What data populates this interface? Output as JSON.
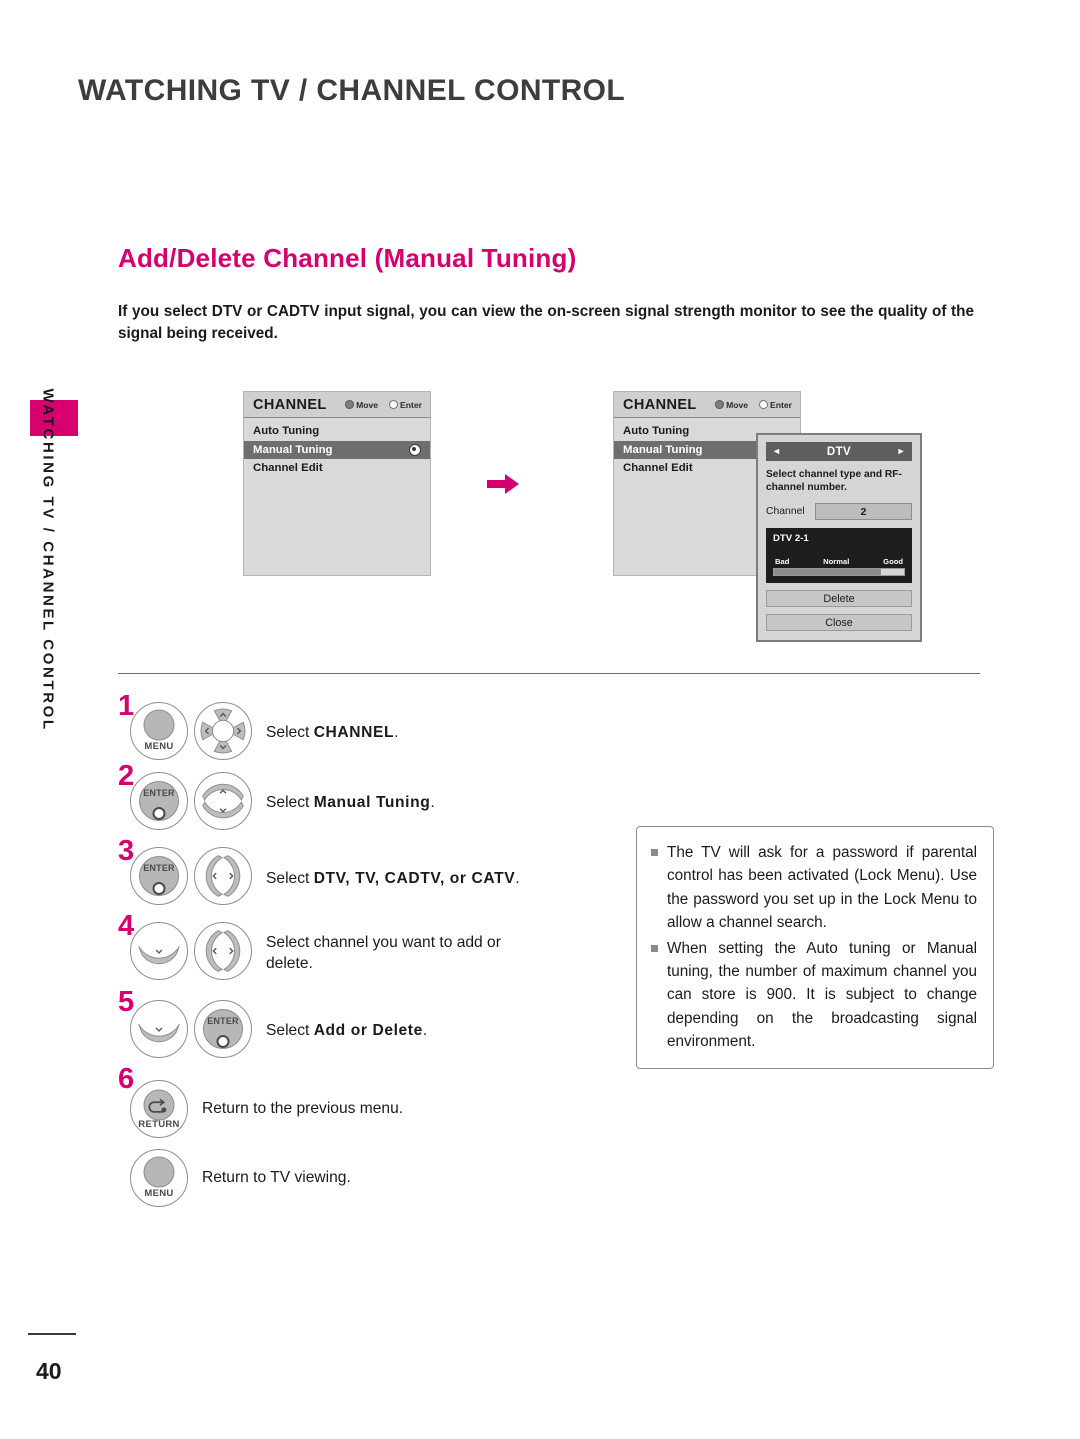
{
  "running_head": "WATCHING TV / CHANNEL CONTROL",
  "side_tab_label": "WATCHING TV / CHANNEL CONTROL",
  "section": {
    "title": "Add/Delete Channel (Manual Tuning)",
    "intro": "If you select DTV or CADTV input signal, you can view the on-screen signal strength monitor to see the quality of the signal being received."
  },
  "osd_left": {
    "header_title": "CHANNEL",
    "hint_move": "Move",
    "hint_enter": "Enter",
    "rows": [
      {
        "label": "Auto Tuning",
        "selected": false
      },
      {
        "label": "Manual Tuning",
        "selected": true
      },
      {
        "label": "Channel Edit",
        "selected": false
      }
    ]
  },
  "osd_right": {
    "header_title": "CHANNEL",
    "hint_move": "Move",
    "hint_enter": "Enter",
    "rows": [
      {
        "label": "Auto Tuning",
        "selected": false
      },
      {
        "label": "Manual Tuning",
        "selected": true
      },
      {
        "label": "Channel Edit",
        "selected": false
      }
    ]
  },
  "dtv_dialog": {
    "title": "DTV",
    "prev_arrow": "◄",
    "next_arrow": "►",
    "description": "Select channel type and RF-channel number.",
    "channel_label": "Channel",
    "channel_value": "2",
    "signal_id": "DTV 2-1",
    "scale_bad": "Bad",
    "scale_normal": "Normal",
    "scale_good": "Good",
    "signal_percent": 82,
    "delete_button": "Delete",
    "close_button": "Close"
  },
  "steps": [
    {
      "num": "1",
      "text_plain": "Select ",
      "text_bold": "CHANNEL",
      "text_tail": "."
    },
    {
      "num": "2",
      "text_plain": "Select ",
      "text_bold": "Manual Tuning",
      "text_tail": "."
    },
    {
      "num": "3",
      "text_plain": "Select ",
      "text_bold": "DTV, TV, CADTV, or CATV",
      "text_tail": "."
    },
    {
      "num": "4",
      "text_plain": "Select channel you want to add or delete.",
      "text_bold": "",
      "text_tail": ""
    },
    {
      "num": "5",
      "text_plain": "Select ",
      "text_bold": "Add or Delete",
      "text_tail": "."
    },
    {
      "num": "6",
      "text_plain": "Return to the previous menu.",
      "text_bold": "",
      "text_tail": ""
    },
    {
      "num": "",
      "text_plain": "Return to TV viewing.",
      "text_bold": "",
      "text_tail": ""
    }
  ],
  "buttons": {
    "menu": "MENU",
    "enter": "ENTER",
    "return": "RETURN"
  },
  "notes": [
    "The TV will ask for a password if parental control has been activated (Lock Menu). Use the password you set up in the Lock Menu to allow a channel search.",
    "When setting the Auto tuning or Manual tuning, the number of maximum channel you can store is 900. It is subject to change depending on the broadcasting signal environment."
  ],
  "page_number": "40",
  "colors": {
    "accent": "#d6006e",
    "text": "#1b1b1b",
    "osd_bg": "#d9d9d9",
    "osd_selected": "#6e6e6e"
  }
}
